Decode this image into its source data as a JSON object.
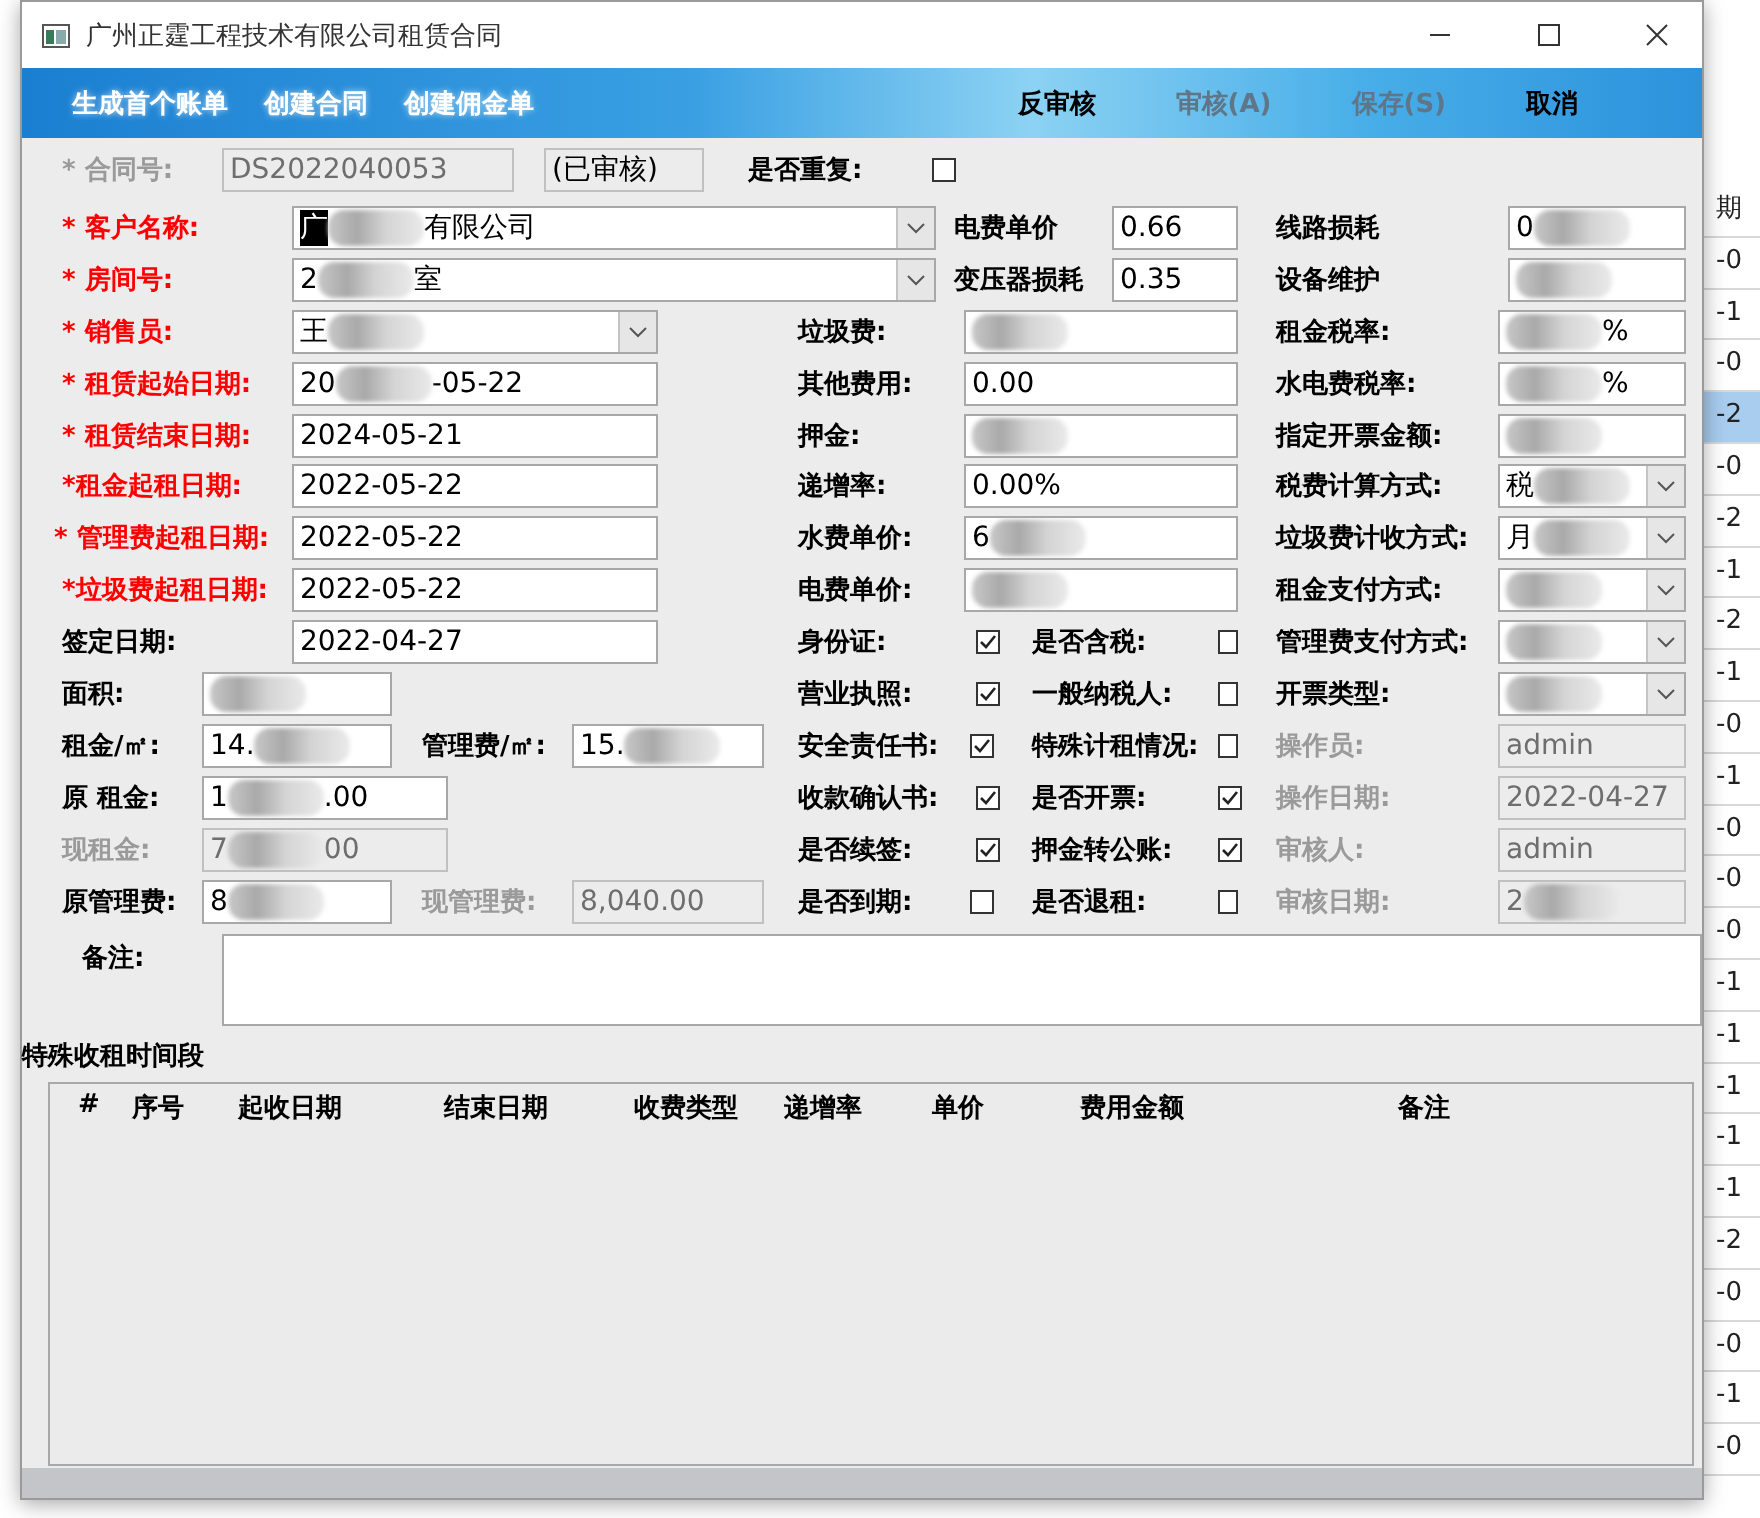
{
  "backdrop": {
    "right_cells": [
      {
        "text": "期",
        "selected": false
      },
      {
        "text": "-0",
        "selected": false
      },
      {
        "text": "-1",
        "selected": false
      },
      {
        "text": "-0",
        "selected": false
      },
      {
        "text": "-2",
        "selected": true
      },
      {
        "text": "-0",
        "selected": false
      },
      {
        "text": "-2",
        "selected": false
      },
      {
        "text": "-1",
        "selected": false
      },
      {
        "text": "-2",
        "selected": false
      },
      {
        "text": "-1",
        "selected": false
      },
      {
        "text": "-0",
        "selected": false
      },
      {
        "text": "-1",
        "selected": false
      },
      {
        "text": "-0",
        "selected": false
      },
      {
        "text": "-0",
        "selected": false
      },
      {
        "text": "-0",
        "selected": false
      },
      {
        "text": "-1",
        "selected": false
      },
      {
        "text": "-1",
        "selected": false
      },
      {
        "text": "-1",
        "selected": false
      },
      {
        "text": "-1",
        "selected": false
      },
      {
        "text": "-1",
        "selected": false
      },
      {
        "text": "-2",
        "selected": false
      },
      {
        "text": "-0",
        "selected": false
      },
      {
        "text": "-0",
        "selected": false
      },
      {
        "text": "-1",
        "selected": false
      },
      {
        "text": "-0",
        "selected": false
      }
    ]
  },
  "window": {
    "title": "广州正霆工程技术有限公司租赁合同"
  },
  "toolbar": {
    "left": [
      {
        "label": "生成首个账单",
        "disabled": false
      },
      {
        "label": "创建合同",
        "disabled": false
      },
      {
        "label": "创建佣金单",
        "disabled": false
      }
    ],
    "right": [
      {
        "label": "反审核",
        "disabled": false
      },
      {
        "label": "审核(A)",
        "disabled": true
      },
      {
        "label": "保存(S)",
        "disabled": true
      },
      {
        "label": "取消",
        "disabled": false
      }
    ]
  },
  "header_row": {
    "label": "* 合同号:",
    "contract_no": "DS2022040053",
    "status": "(已审核)",
    "duplicate_label": "是否重复:",
    "duplicate_checked": false
  },
  "rows": [
    {
      "cells": [
        {
          "kind": "label",
          "text": "* 客户名称:",
          "required": true
        },
        {
          "kind": "select",
          "value": "广",
          "suffix": "有限公司",
          "redacted": true,
          "highlighted": true
        },
        {
          "kind": "label",
          "text": "电费单价"
        },
        {
          "kind": "input",
          "value": "0.66"
        },
        {
          "kind": "label",
          "text": "线路损耗"
        },
        {
          "kind": "input",
          "value": "0",
          "redacted": true
        }
      ]
    },
    {
      "cells": [
        {
          "kind": "label",
          "text": "* 房间号:",
          "required": true
        },
        {
          "kind": "select",
          "value": "2",
          "suffix": "室",
          "redacted": true
        },
        {
          "kind": "label",
          "text": "变压器损耗"
        },
        {
          "kind": "input",
          "value": "0.35"
        },
        {
          "kind": "label",
          "text": "设备维护"
        },
        {
          "kind": "input",
          "redacted": true
        }
      ]
    },
    {
      "cells": [
        {
          "kind": "label",
          "text": "* 销售员:",
          "required": true
        },
        {
          "kind": "select",
          "value": "王",
          "redacted": true
        },
        {
          "kind": "label",
          "text": "垃圾费:"
        },
        {
          "kind": "input",
          "redacted": true
        },
        {
          "kind": "label",
          "text": "租金税率:"
        },
        {
          "kind": "input",
          "suffix": "%",
          "redacted": true
        }
      ]
    },
    {
      "cells": [
        {
          "kind": "label",
          "text": "* 租赁起始日期:",
          "required": true
        },
        {
          "kind": "input",
          "value": "20",
          "suffix": "-05-22",
          "redacted": true
        },
        {
          "kind": "label",
          "text": "其他费用:"
        },
        {
          "kind": "input",
          "value": "0.00"
        },
        {
          "kind": "label",
          "text": "水电费税率:"
        },
        {
          "kind": "input",
          "suffix": "%",
          "redacted": true
        }
      ]
    },
    {
      "cells": [
        {
          "kind": "label",
          "text": "* 租赁结束日期:",
          "required": true
        },
        {
          "kind": "input",
          "value": "2024-05-21"
        },
        {
          "kind": "label",
          "text": "押金:"
        },
        {
          "kind": "input",
          "redacted": true
        },
        {
          "kind": "label",
          "text": "指定开票金额:"
        },
        {
          "kind": "input",
          "redacted": true
        }
      ]
    },
    {
      "cells": [
        {
          "kind": "label",
          "text": "*租金起租日期:",
          "required": true
        },
        {
          "kind": "input",
          "value": "2022-05-22"
        },
        {
          "kind": "label",
          "text": "递增率:"
        },
        {
          "kind": "input",
          "value": "0.00%"
        },
        {
          "kind": "label",
          "text": "税费计算方式:"
        },
        {
          "kind": "select",
          "value": "税",
          "redacted": true
        }
      ]
    },
    {
      "cells": [
        {
          "kind": "label",
          "text": "* 管理费起租日期:",
          "required": true
        },
        {
          "kind": "input",
          "value": "2022-05-22"
        },
        {
          "kind": "label",
          "text": "水费单价:"
        },
        {
          "kind": "input",
          "value": "6",
          "redacted": true
        },
        {
          "kind": "label",
          "text": "垃圾费计收方式:"
        },
        {
          "kind": "select",
          "value": "月",
          "redacted": true
        }
      ]
    },
    {
      "cells": [
        {
          "kind": "label",
          "text": "*垃圾费起租日期:",
          "required": true
        },
        {
          "kind": "input",
          "value": "2022-05-22"
        },
        {
          "kind": "label",
          "text": "电费单价:"
        },
        {
          "kind": "input",
          "redacted": true
        },
        {
          "kind": "label",
          "text": "租金支付方式:"
        },
        {
          "kind": "select",
          "redacted": true
        }
      ]
    },
    {
      "cells": [
        {
          "kind": "label",
          "text": "签定日期:"
        },
        {
          "kind": "input",
          "value": "2022-04-27"
        },
        {
          "kind": "label",
          "text": "身份证:"
        },
        {
          "kind": "checkbox",
          "checked": true
        },
        {
          "kind": "label",
          "text": "是否含税:"
        },
        {
          "kind": "checkbox",
          "checked": false
        },
        {
          "kind": "label",
          "text": "管理费支付方式:"
        },
        {
          "kind": "select",
          "redacted": true
        }
      ]
    },
    {
      "cells": [
        {
          "kind": "label",
          "text": "面积:"
        },
        {
          "kind": "input",
          "redacted": true
        },
        {
          "kind": "label",
          "text": "营业执照:"
        },
        {
          "kind": "checkbox",
          "checked": true
        },
        {
          "kind": "label",
          "text": "一般纳税人:"
        },
        {
          "kind": "checkbox",
          "checked": false
        },
        {
          "kind": "label",
          "text": "开票类型:"
        },
        {
          "kind": "select",
          "redacted": true
        }
      ]
    },
    {
      "cells": [
        {
          "kind": "label",
          "text": "租金/㎡:"
        },
        {
          "kind": "input",
          "value": "14.",
          "redacted": true
        },
        {
          "kind": "label",
          "text": "管理费/㎡:"
        },
        {
          "kind": "input",
          "value": "15.",
          "redacted": true
        },
        {
          "kind": "label",
          "text": "安全责任书:"
        },
        {
          "kind": "checkbox",
          "checked": true
        },
        {
          "kind": "label",
          "text": "特殊计租情况:"
        },
        {
          "kind": "checkbox",
          "checked": false
        },
        {
          "kind": "label",
          "text": "操作员:",
          "disabled": true
        },
        {
          "kind": "input",
          "value": "admin",
          "disabled": true
        }
      ]
    },
    {
      "cells": [
        {
          "kind": "label",
          "text": "原 租金:"
        },
        {
          "kind": "input",
          "value": "1",
          "suffix": ".00",
          "redacted": true
        },
        {
          "kind": "label",
          "text": "收款确认书:"
        },
        {
          "kind": "checkbox",
          "checked": true
        },
        {
          "kind": "label",
          "text": "是否开票:"
        },
        {
          "kind": "checkbox",
          "checked": true
        },
        {
          "kind": "label",
          "text": "操作日期:",
          "disabled": true
        },
        {
          "kind": "input",
          "value": "2022-04-27",
          "disabled": true
        }
      ]
    },
    {
      "cells": [
        {
          "kind": "label",
          "text": "现租金:",
          "disabled": true
        },
        {
          "kind": "input",
          "value": "7",
          "suffix": "00",
          "redacted": true,
          "disabled": true
        },
        {
          "kind": "label",
          "text": "是否续签:"
        },
        {
          "kind": "checkbox",
          "checked": true
        },
        {
          "kind": "label",
          "text": "押金转公账:"
        },
        {
          "kind": "checkbox",
          "checked": true
        },
        {
          "kind": "label",
          "text": "审核人:",
          "disabled": true
        },
        {
          "kind": "input",
          "value": "admin",
          "disabled": true
        }
      ]
    },
    {
      "cells": [
        {
          "kind": "label",
          "text": "原管理费:"
        },
        {
          "kind": "input",
          "value": "8",
          "redacted": true
        },
        {
          "kind": "label",
          "text": "现管理费:",
          "disabled": true
        },
        {
          "kind": "input",
          "value": "8,040.00",
          "disabled": true
        },
        {
          "kind": "label",
          "text": "是否到期:"
        },
        {
          "kind": "checkbox",
          "checked": false
        },
        {
          "kind": "label",
          "text": "是否退租:"
        },
        {
          "kind": "checkbox",
          "checked": false
        },
        {
          "kind": "label",
          "text": "审核日期:",
          "disabled": true
        },
        {
          "kind": "input",
          "value": "2",
          "redacted": true,
          "disabled": true
        }
      ]
    }
  ],
  "remarks": {
    "label": "备注:"
  },
  "special_periods": {
    "title": "特殊收租时间段",
    "columns": [
      "#",
      "序号",
      "起收日期",
      "结束日期",
      "收费类型",
      "递增率",
      "单价",
      "费用金额",
      "备注"
    ]
  }
}
